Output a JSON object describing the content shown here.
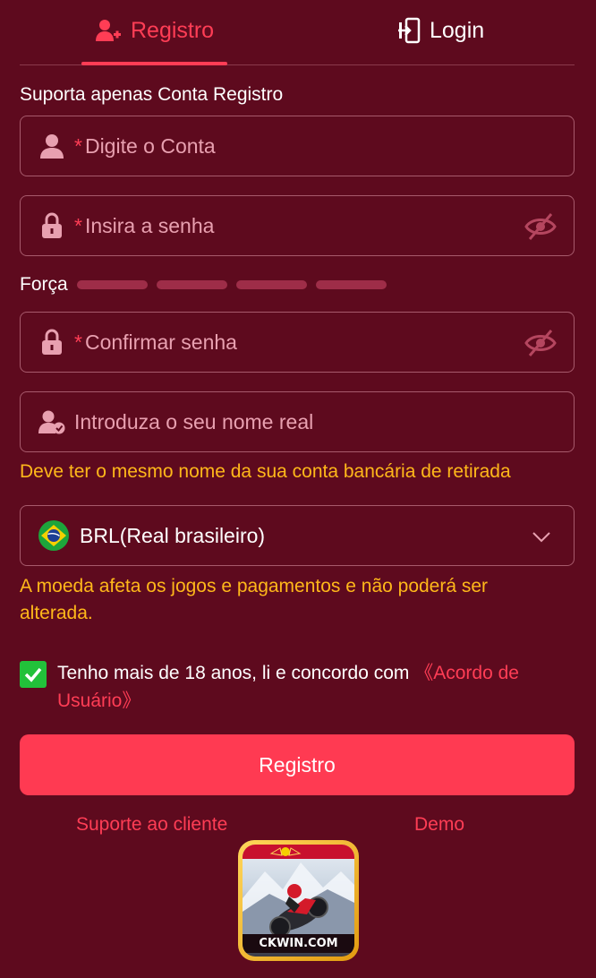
{
  "tabs": {
    "register_label": "Registro",
    "login_label": "Login"
  },
  "form": {
    "section_label": "Suporta apenas Conta Registro",
    "required_mark": "*",
    "account_placeholder": "Digite o Conta",
    "password_placeholder": "Insira a senha",
    "strength_label": "Força",
    "confirm_placeholder": "Confirmar senha",
    "realname_placeholder": "Introduza o seu nome real",
    "realname_hint": "Deve ter o mesmo nome da sua conta bancária de retirada",
    "currency_value": "BRL(Real brasileiro)",
    "currency_hint": "A moeda afeta os jogos e pagamentos e não poderá ser alterada.",
    "agree_text": "Tenho mais de 18 anos, li e concordo com ",
    "agree_link": "《Acordo de Usuário》",
    "agree_checked": true,
    "submit_label": "Registro"
  },
  "footer": {
    "support_label": "Suporte ao cliente",
    "demo_label": "Demo"
  },
  "logo": {
    "text": "CKWIN.COM"
  },
  "colors": {
    "background": "#5e0a1e",
    "accent": "#ff3d55",
    "hint": "#ffb81a",
    "checkbox": "#22c13a"
  }
}
